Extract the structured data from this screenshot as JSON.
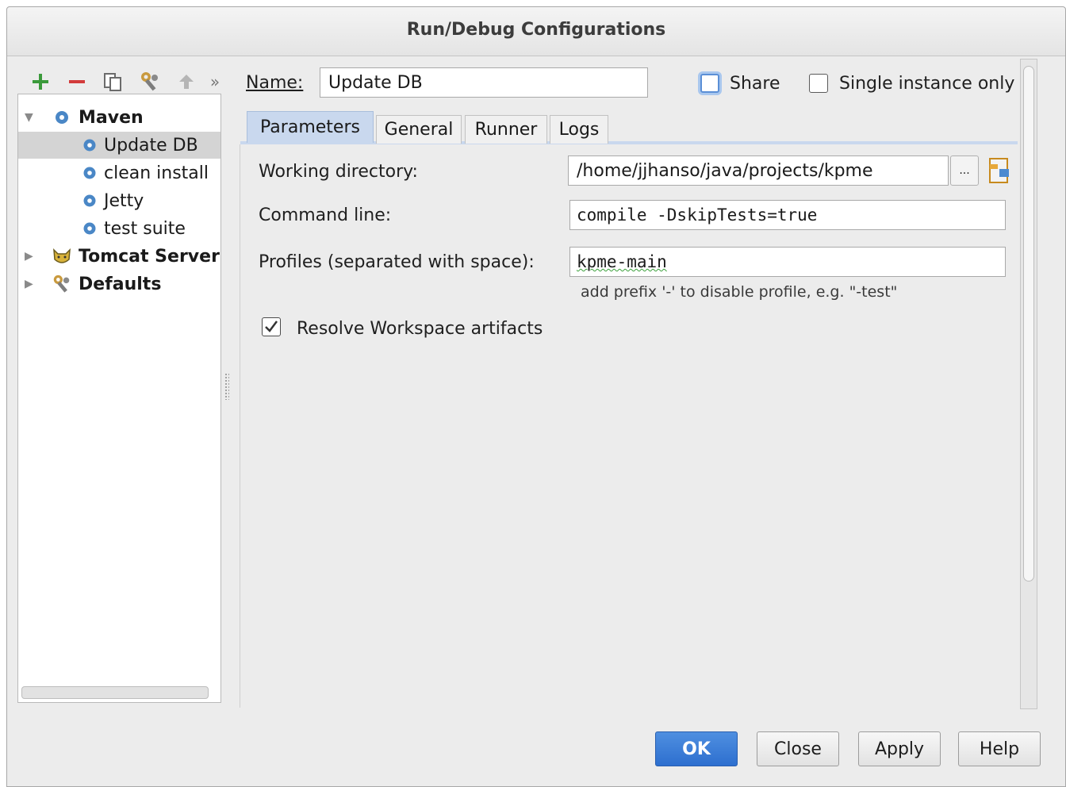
{
  "dialog": {
    "title": "Run/Debug Configurations"
  },
  "toolbar": {
    "add": "add-icon",
    "remove": "remove-icon",
    "copy": "copy-icon",
    "edit_defaults": "wrench-icon",
    "move_up": "arrow-up-icon",
    "more": "»"
  },
  "tree": {
    "maven": "Maven",
    "items": [
      "Update DB",
      "clean install",
      "Jetty",
      "test suite"
    ],
    "tomcat": "Tomcat Server",
    "defaults": "Defaults"
  },
  "name": {
    "label": "Name:",
    "value": "Update DB"
  },
  "share": {
    "label": "Share",
    "checked": false
  },
  "single_instance": {
    "label": "Single instance only",
    "checked": false
  },
  "tabs": [
    "Parameters",
    "General",
    "Runner",
    "Logs"
  ],
  "params": {
    "working_dir_label": "Working directory:",
    "working_dir_value": "/home/jjhanso/java/projects/kpme",
    "browse": "...",
    "command_line_label": "Command line:",
    "command_line_value": "compile -DskipTests=true",
    "profiles_label": "Profiles (separated with space):",
    "profiles_value": "kpme-main",
    "profiles_hint": "add prefix '-' to disable profile, e.g. \"-test\"",
    "resolve_label": "Resolve Workspace artifacts",
    "resolve_checked": true
  },
  "buttons": {
    "ok": "OK",
    "close": "Close",
    "apply": "Apply",
    "help": "Help"
  },
  "colors": {
    "accent": "#2d6fcf",
    "tab_active": "#c9d8ee",
    "add_green": "#3b9a3b",
    "remove_red": "#d23b3b"
  }
}
